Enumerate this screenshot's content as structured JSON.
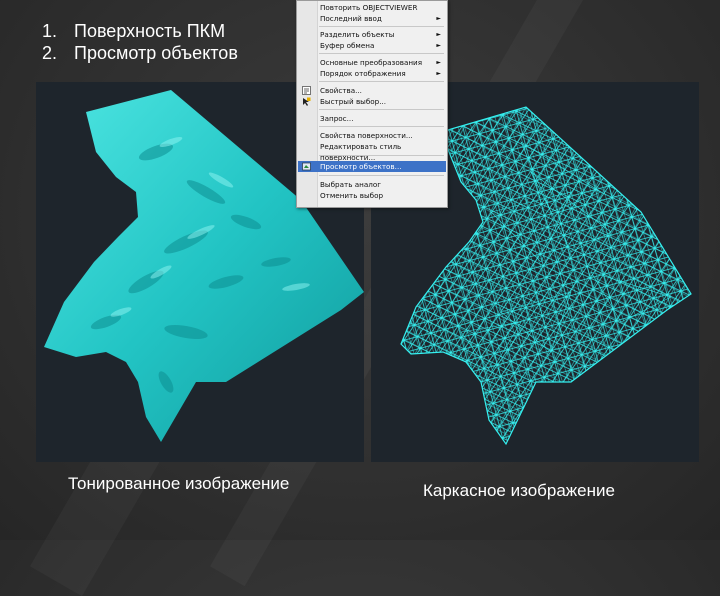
{
  "bullets": [
    {
      "num": "1.",
      "text": "Поверхность ПКМ"
    },
    {
      "num": "2.",
      "text": "Просмотр объектов"
    }
  ],
  "captions": {
    "left": "Тонированное изображение",
    "right": "Каркасное изображение"
  },
  "context_menu": {
    "items": [
      {
        "label": "Повторить OBJECTVIEWER",
        "submenu": false
      },
      {
        "label": "Последний ввод",
        "submenu": true
      },
      {
        "label": "Разделить объекты",
        "submenu": true
      },
      {
        "label": "Буфер обмена",
        "submenu": true
      },
      {
        "label": "Основные преобразования",
        "submenu": true
      },
      {
        "label": "Порядок отображения",
        "submenu": true
      },
      {
        "label": "Свойства...",
        "submenu": false,
        "icon": "properties-icon"
      },
      {
        "label": "Быстрый выбор...",
        "submenu": false,
        "icon": "quick-select-icon"
      },
      {
        "label": "Запрос...",
        "submenu": false
      },
      {
        "label": "Свойства поверхности...",
        "submenu": false
      },
      {
        "label": "Редактировать стиль поверхности...",
        "submenu": false
      },
      {
        "label": "Просмотр объектов...",
        "submenu": false,
        "icon": "object-viewer-icon",
        "highlighted": true
      },
      {
        "label": "Выбрать аналог",
        "submenu": false
      },
      {
        "label": "Отменить выбор",
        "submenu": false
      }
    ],
    "submenu_arrow": "►"
  },
  "colors": {
    "surface_cyan": "#20c8c8",
    "wire_cyan": "#35f0f0",
    "viewport_bg": "#1e252c",
    "highlight": "#3d72c7"
  }
}
